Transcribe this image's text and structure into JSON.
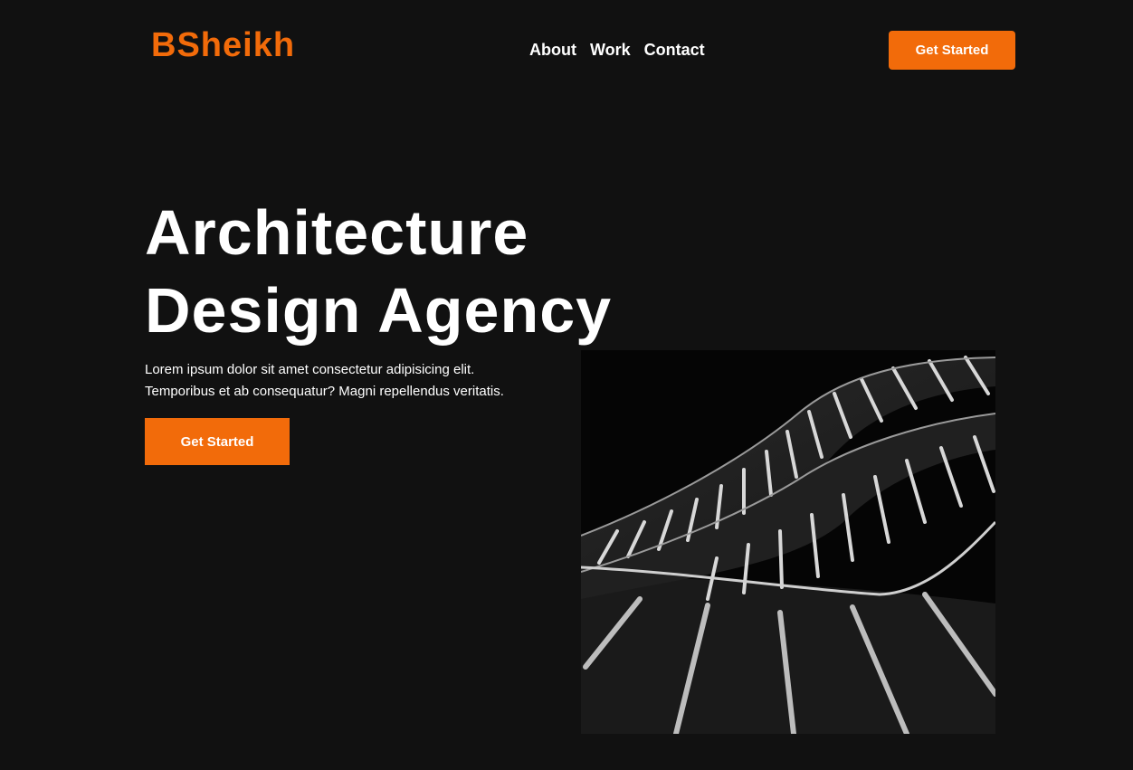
{
  "header": {
    "logo": "BSheikh",
    "nav": [
      "About",
      "Work",
      "Contact"
    ],
    "cta_label": "Get Started"
  },
  "hero": {
    "title_lines": [
      "Architecture",
      "Design Agency"
    ],
    "description_lines": [
      "Lorem ipsum dolor sit amet consectetur adipisicing elit.",
      "Temporibus et ab consequatur? Magni repellendus veritatis."
    ],
    "cta_label": "Get Started"
  },
  "colors": {
    "accent": "#f26b0a",
    "background": "#111111",
    "text": "#ffffff"
  }
}
